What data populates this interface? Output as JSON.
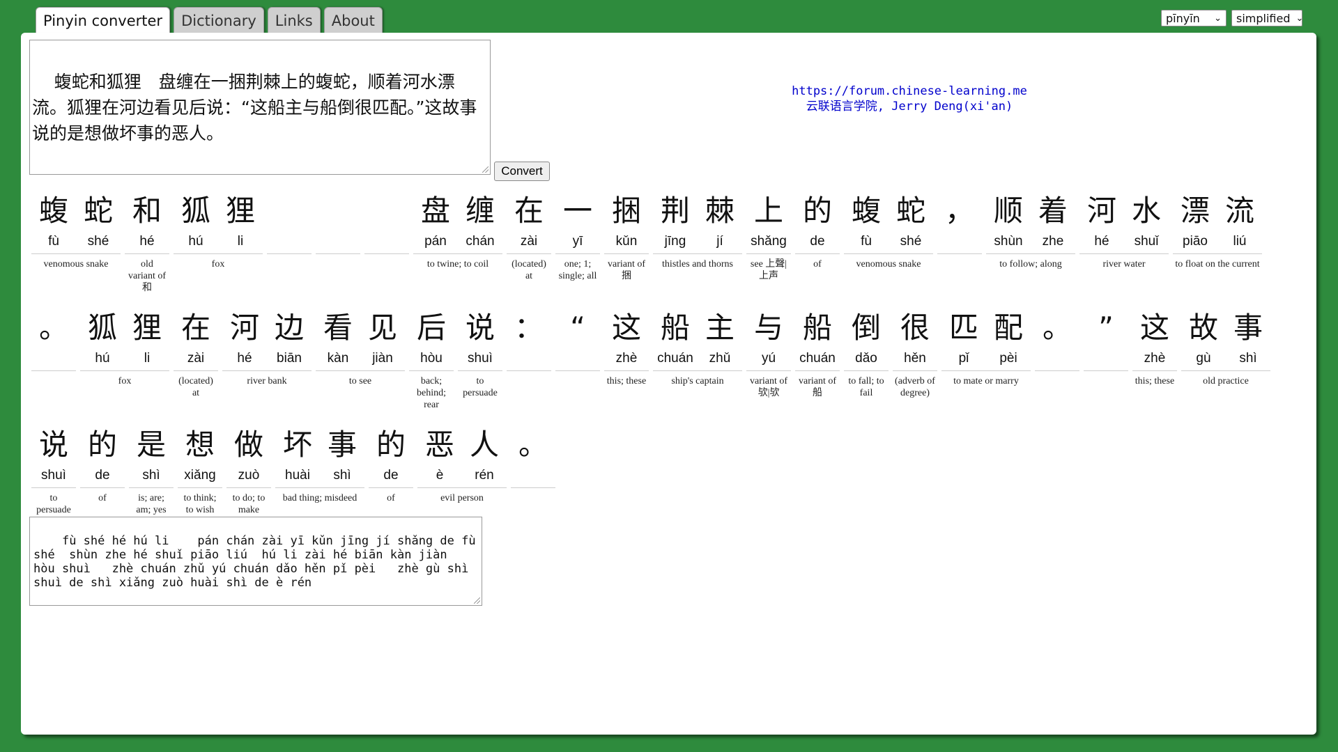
{
  "tabs": [
    {
      "label": "Pinyin converter",
      "active": true
    },
    {
      "label": "Dictionary",
      "active": false
    },
    {
      "label": "Links",
      "active": false
    },
    {
      "label": "About",
      "active": false
    }
  ],
  "settings": {
    "romanization": "pīnyīn",
    "script": "simplified"
  },
  "input_text": "蝮蛇和狐狸　盘缠在一捆荆棘上的蝮蛇，顺着河水漂流。狐狸在河边看见后说：“这船主与船倒很匹配。”这故事说的是想做坏事的恶人。",
  "convert_label": "Convert",
  "credits": {
    "url": "https://forum.chinese-learning.me",
    "author": "云联语言学院, Jerry Deng(xi'an)"
  },
  "rows": [
    [
      {
        "chars": [
          [
            "蝮",
            "fù"
          ],
          [
            "蛇",
            "shé"
          ]
        ],
        "gloss": "venomous snake"
      },
      {
        "chars": [
          [
            "和",
            "hé"
          ]
        ],
        "gloss": "old variant of 和"
      },
      {
        "chars": [
          [
            "狐",
            "hú"
          ],
          [
            "狸",
            "li"
          ]
        ],
        "gloss": "fox"
      },
      {
        "chars": [
          [
            "",
            ""
          ]
        ],
        "gloss": ""
      },
      {
        "chars": [
          [
            "",
            ""
          ]
        ],
        "gloss": ""
      },
      {
        "chars": [
          [
            "",
            ""
          ]
        ],
        "gloss": ""
      },
      {
        "chars": [
          [
            "盘",
            "pán"
          ],
          [
            "缠",
            "chán"
          ]
        ],
        "gloss": "to twine; to coil"
      },
      {
        "chars": [
          [
            "在",
            "zài"
          ]
        ],
        "gloss": "(located) at"
      },
      {
        "chars": [
          [
            "一",
            "yī"
          ]
        ],
        "gloss": "one; 1; single; all"
      },
      {
        "chars": [
          [
            "捆",
            "kǔn"
          ]
        ],
        "gloss": "variant of 捆"
      },
      {
        "chars": [
          [
            "荆",
            "jīng"
          ],
          [
            "棘",
            "jí"
          ]
        ],
        "gloss": "thistles and thorns"
      },
      {
        "chars": [
          [
            "上",
            "shǎng"
          ]
        ],
        "gloss": "see 上聲|上声"
      },
      {
        "chars": [
          [
            "的",
            "de"
          ]
        ],
        "gloss": "of"
      },
      {
        "chars": [
          [
            "蝮",
            "fù"
          ],
          [
            "蛇",
            "shé"
          ]
        ],
        "gloss": "venomous snake"
      },
      {
        "chars": [
          [
            "，",
            ""
          ]
        ],
        "gloss": ""
      },
      {
        "chars": [
          [
            "顺",
            "shùn"
          ],
          [
            "着",
            "zhe"
          ]
        ],
        "gloss": "to follow; along"
      },
      {
        "chars": [
          [
            "河",
            "hé"
          ],
          [
            "水",
            "shuǐ"
          ]
        ],
        "gloss": "river water"
      },
      {
        "chars": [
          [
            "漂",
            "piāo"
          ],
          [
            "流",
            "liú"
          ]
        ],
        "gloss": "to float on the current"
      }
    ],
    [
      {
        "chars": [
          [
            "。",
            ""
          ]
        ],
        "gloss": ""
      },
      {
        "chars": [
          [
            "狐",
            "hú"
          ],
          [
            "狸",
            "li"
          ]
        ],
        "gloss": "fox"
      },
      {
        "chars": [
          [
            "在",
            "zài"
          ]
        ],
        "gloss": "(located) at"
      },
      {
        "chars": [
          [
            "河",
            "hé"
          ],
          [
            "边",
            "biān"
          ]
        ],
        "gloss": "river bank"
      },
      {
        "chars": [
          [
            "看",
            "kàn"
          ],
          [
            "见",
            "jiàn"
          ]
        ],
        "gloss": "to see"
      },
      {
        "chars": [
          [
            "后",
            "hòu"
          ]
        ],
        "gloss": "back; behind; rear"
      },
      {
        "chars": [
          [
            "说",
            "shuì"
          ]
        ],
        "gloss": "to persuade"
      },
      {
        "chars": [
          [
            "：",
            ""
          ]
        ],
        "gloss": ""
      },
      {
        "chars": [
          [
            "“",
            ""
          ]
        ],
        "gloss": ""
      },
      {
        "chars": [
          [
            "这",
            "zhè"
          ]
        ],
        "gloss": "this; these"
      },
      {
        "chars": [
          [
            "船",
            "chuán"
          ],
          [
            "主",
            "zhǔ"
          ]
        ],
        "gloss": "ship's captain"
      },
      {
        "chars": [
          [
            "与",
            "yú"
          ]
        ],
        "gloss": "variant of 欤|欤"
      },
      {
        "chars": [
          [
            "船",
            "chuán"
          ]
        ],
        "gloss": "variant of 船"
      },
      {
        "chars": [
          [
            "倒",
            "dǎo"
          ]
        ],
        "gloss": "to fall; to fail"
      },
      {
        "chars": [
          [
            "很",
            "hěn"
          ]
        ],
        "gloss": "(adverb of degree)"
      },
      {
        "chars": [
          [
            "匹",
            "pǐ"
          ],
          [
            "配",
            "pèi"
          ]
        ],
        "gloss": "to mate or marry"
      },
      {
        "chars": [
          [
            "。",
            ""
          ]
        ],
        "gloss": ""
      },
      {
        "chars": [
          [
            "”",
            ""
          ]
        ],
        "gloss": ""
      },
      {
        "chars": [
          [
            "这",
            "zhè"
          ]
        ],
        "gloss": "this; these"
      },
      {
        "chars": [
          [
            "故",
            "gù"
          ],
          [
            "事",
            "shì"
          ]
        ],
        "gloss": "old practice"
      }
    ],
    [
      {
        "chars": [
          [
            "说",
            "shuì"
          ]
        ],
        "gloss": "to persuade"
      },
      {
        "chars": [
          [
            "的",
            "de"
          ]
        ],
        "gloss": "of"
      },
      {
        "chars": [
          [
            "是",
            "shì"
          ]
        ],
        "gloss": "is; are; am; yes"
      },
      {
        "chars": [
          [
            "想",
            "xiǎng"
          ]
        ],
        "gloss": "to think; to wish"
      },
      {
        "chars": [
          [
            "做",
            "zuò"
          ]
        ],
        "gloss": "to do; to make"
      },
      {
        "chars": [
          [
            "坏",
            "huài"
          ],
          [
            "事",
            "shì"
          ]
        ],
        "gloss": "bad thing; misdeed"
      },
      {
        "chars": [
          [
            "的",
            "de"
          ]
        ],
        "gloss": "of"
      },
      {
        "chars": [
          [
            "恶",
            "è"
          ],
          [
            "人",
            "rén"
          ]
        ],
        "gloss": "evil person"
      },
      {
        "chars": [
          [
            "。",
            ""
          ]
        ],
        "gloss": ""
      }
    ]
  ],
  "output_text": "fù shé hé hú li    pán chán zài yī kǔn jīng jí shǎng de fù\nshé  shùn zhe hé shuǐ piāo liú  hú li zài hé biān kàn jiàn\nhòu shuì   zhè chuán zhǔ yú chuán dǎo hěn pǐ pèi   zhè gù shì\nshuì de shì xiǎng zuò huài shì de è rén"
}
